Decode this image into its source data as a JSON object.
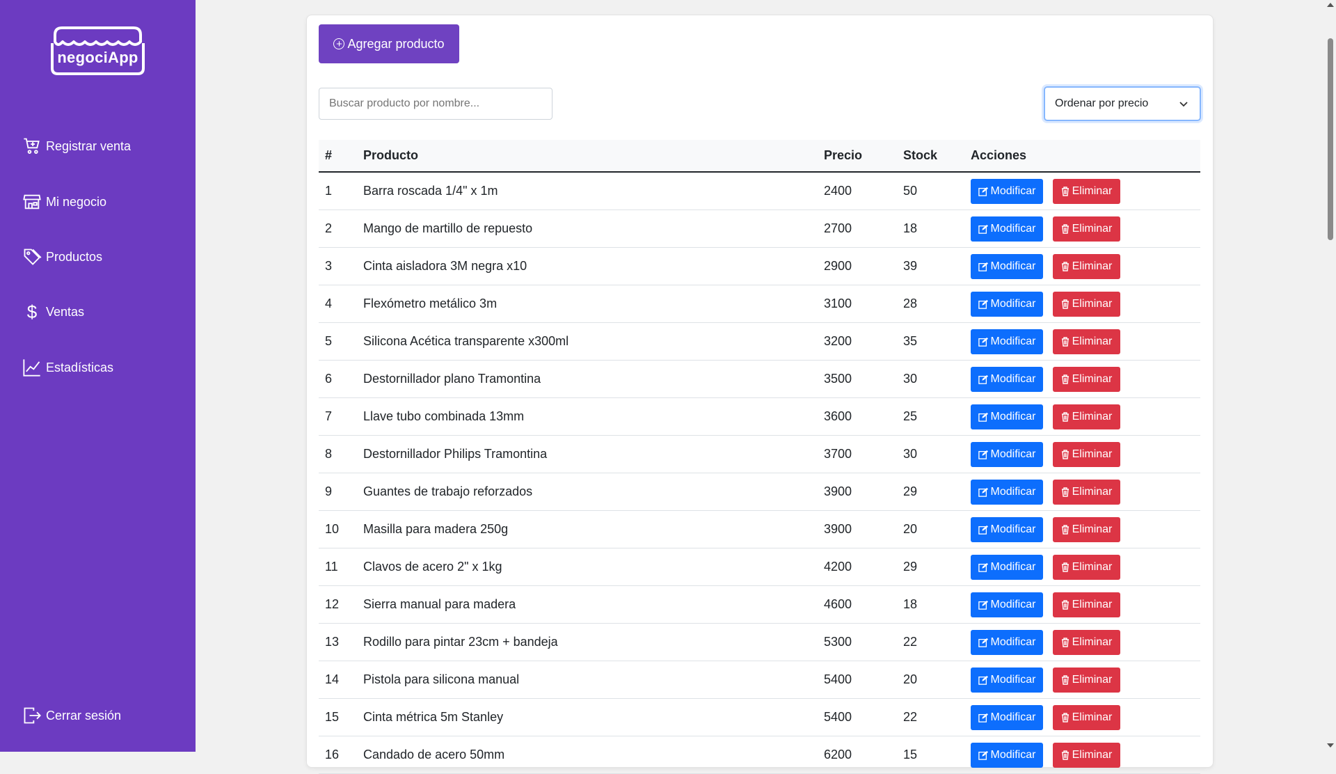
{
  "brand": {
    "name": "negociApp"
  },
  "sidebar": {
    "items": [
      {
        "label": "Registrar venta",
        "icon": "cart-plus-icon"
      },
      {
        "label": "Mi negocio",
        "icon": "shop-icon"
      },
      {
        "label": "Productos",
        "icon": "tags-icon"
      },
      {
        "label": "Ventas",
        "icon": "dollar-icon"
      },
      {
        "label": "Estadísticas",
        "icon": "graph-up-icon"
      }
    ],
    "logout": {
      "label": "Cerrar sesión",
      "icon": "box-arrow-right-icon"
    }
  },
  "toolbar": {
    "add_label": "Agregar producto",
    "search_placeholder": "Buscar producto por nombre...",
    "sort_selected": "Ordenar por precio"
  },
  "table": {
    "headers": {
      "num": "#",
      "product": "Producto",
      "price": "Precio",
      "stock": "Stock",
      "actions": "Acciones"
    },
    "edit_label": "Modificar",
    "delete_label": "Eliminar",
    "rows": [
      {
        "num": "1",
        "product": "Barra roscada 1/4\" x 1m",
        "price": "2400",
        "stock": "50"
      },
      {
        "num": "2",
        "product": "Mango de martillo de repuesto",
        "price": "2700",
        "stock": "18"
      },
      {
        "num": "3",
        "product": "Cinta aisladora 3M negra x10",
        "price": "2900",
        "stock": "39"
      },
      {
        "num": "4",
        "product": "Flexómetro metálico 3m",
        "price": "3100",
        "stock": "28"
      },
      {
        "num": "5",
        "product": "Silicona Acética transparente x300ml",
        "price": "3200",
        "stock": "35"
      },
      {
        "num": "6",
        "product": "Destornillador plano Tramontina",
        "price": "3500",
        "stock": "30"
      },
      {
        "num": "7",
        "product": "Llave tubo combinada 13mm",
        "price": "3600",
        "stock": "25"
      },
      {
        "num": "8",
        "product": "Destornillador Philips Tramontina",
        "price": "3700",
        "stock": "30"
      },
      {
        "num": "9",
        "product": "Guantes de trabajo reforzados",
        "price": "3900",
        "stock": "29"
      },
      {
        "num": "10",
        "product": "Masilla para madera 250g",
        "price": "3900",
        "stock": "20"
      },
      {
        "num": "11",
        "product": "Clavos de acero 2\" x 1kg",
        "price": "4200",
        "stock": "29"
      },
      {
        "num": "12",
        "product": "Sierra manual para madera",
        "price": "4600",
        "stock": "18"
      },
      {
        "num": "13",
        "product": "Rodillo para pintar 23cm + bandeja",
        "price": "5300",
        "stock": "22"
      },
      {
        "num": "14",
        "product": "Pistola para silicona manual",
        "price": "5400",
        "stock": "20"
      },
      {
        "num": "15",
        "product": "Cinta métrica 5m Stanley",
        "price": "5400",
        "stock": "22"
      },
      {
        "num": "16",
        "product": "Candado de acero 50mm",
        "price": "6200",
        "stock": "15"
      }
    ]
  },
  "colors": {
    "sidebar": "#6c3bc1",
    "primary": "#6f42c1",
    "edit": "#0d6efd",
    "delete": "#dc3545"
  }
}
